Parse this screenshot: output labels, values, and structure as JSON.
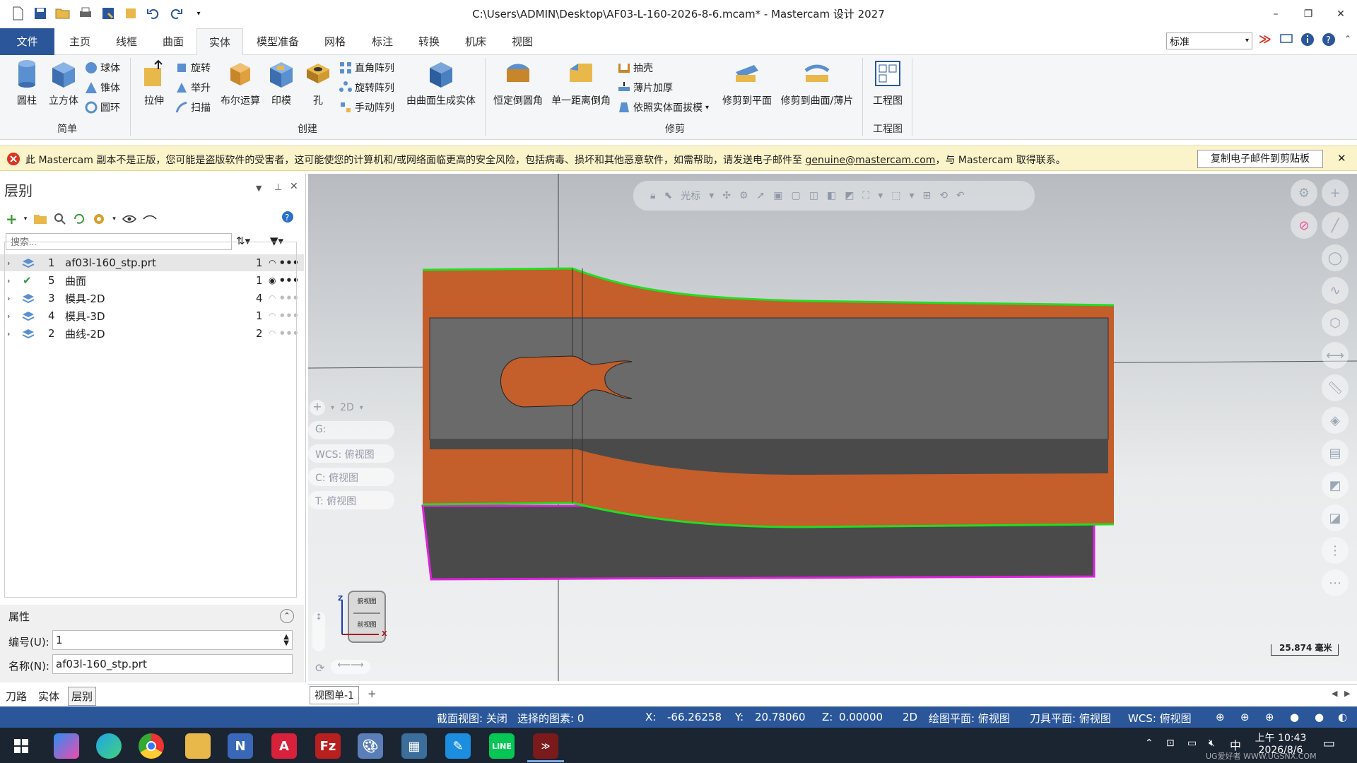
{
  "titlebar": {
    "title": "C:\\Users\\ADMIN\\Desktop\\AF03-L-160-2026-8-6.mcam* - Mastercam 设计 2027",
    "minimize": "–",
    "restore": "❐",
    "close": "✕"
  },
  "tabs": [
    "文件",
    "主页",
    "线框",
    "曲面",
    "实体",
    "模型准备",
    "网格",
    "标注",
    "转换",
    "机床",
    "视图"
  ],
  "active_tab": "实体",
  "style_select": "标准",
  "ribbon": {
    "simple": {
      "cylinder": "圆柱",
      "box": "立方体",
      "sphere": "球体",
      "cone": "锥体",
      "torus": "圆环",
      "group": "简单"
    },
    "create": {
      "extrude": "拉伸",
      "revolve": "旋转",
      "loft": "举升",
      "sweep": "扫描",
      "boolean": "布尔运算",
      "imprint": "印模",
      "hole": "孔",
      "rect_pattern": "直角阵列",
      "rot_pattern": "旋转阵列",
      "manual_pattern": "手动阵列",
      "from_surfaces": "由曲面生成实体",
      "group": "创建"
    },
    "modify": {
      "const_fillet": "恒定倒圆角",
      "one_dist_chamfer": "单一距离倒角",
      "shell": "抽壳",
      "thicken": "薄片加厚",
      "draft": "依照实体面拔模",
      "trim_plane": "修剪到平面",
      "trim_surface": "修剪到曲面/薄片",
      "group": "修剪"
    },
    "drawing": {
      "layout": "工程图",
      "group": "工程图"
    }
  },
  "warning": {
    "text": "此 Mastercam 副本不是正版，您可能是盗版软件的受害者，这可能使您的计算机和/或网络面临更高的安全风险，包括病毒、损坏和其他恶意软件，如需帮助，请发送电子邮件至 ",
    "email": "genuine@mastercam.com",
    "suffix": "，与 Mastercam 取得联系。",
    "copy_button": "复制电子邮件到剪贴板"
  },
  "levels_panel": {
    "title": "层别",
    "search_placeholder": "搜索...",
    "rows": [
      {
        "num": "1",
        "name": "af03l-160_stp.prt",
        "count": "1",
        "selected": true
      },
      {
        "num": "5",
        "name": "曲面",
        "count": "1",
        "selected": false
      },
      {
        "num": "3",
        "name": "模具-2D",
        "count": "4",
        "selected": false
      },
      {
        "num": "4",
        "name": "模具-3D",
        "count": "1",
        "selected": false
      },
      {
        "num": "2",
        "name": "曲线-2D",
        "count": "2",
        "selected": false
      }
    ],
    "props_title": "属性",
    "number_label": "编号(U):",
    "number_value": "1",
    "name_label": "名称(N):",
    "name_value": "af03l-160_stp.prt"
  },
  "bottom_tabs": [
    "刀路",
    "实体",
    "层别"
  ],
  "viewport": {
    "toolbar_cursor": "光标",
    "plane_panel": {
      "mode": "2D",
      "g": "G:",
      "wcs": "WCS: 俯视图",
      "c": "C: 俯视图",
      "t": "T: 俯视图"
    },
    "cube_top": "俯视图",
    "cube_front": "前视图",
    "axis_z": "Z",
    "axis_x": "X",
    "scale": "25.874 毫米"
  },
  "view_tab": "视图单-1",
  "view_tab_add": "+",
  "status": {
    "section": "截面视图: 关闭",
    "selected": "选择的图素: 0",
    "x_label": "X:",
    "x": "-66.26258",
    "y_label": "Y:",
    "y": "20.78060",
    "z_label": "Z:",
    "z": "0.00000",
    "mode": "2D",
    "cplane": "绘图平面: 俯视图",
    "tplane": "刀具平面: 俯视图",
    "wcs": "WCS: 俯视图"
  },
  "taskbar": {
    "time": "上午 10:43",
    "date": "2026/8/6",
    "ime": "中",
    "watermark": "UG爱好者 WWW.UGSNX.COM"
  },
  "colors": {
    "accent": "#2b579a",
    "part_orange": "#c45e2a",
    "part_dark": "#555555",
    "edge_green": "#22dd22",
    "edge_magenta": "#dd22dd"
  }
}
